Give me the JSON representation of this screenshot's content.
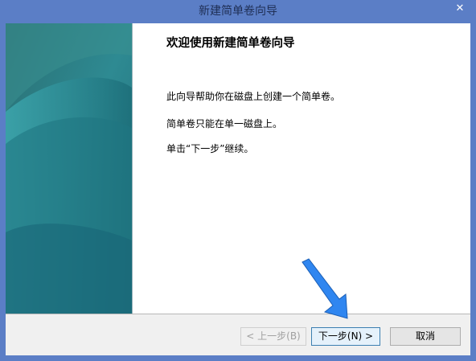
{
  "window": {
    "title": "新建简单卷向导",
    "close_label": "✕"
  },
  "content": {
    "heading": "欢迎使用新建简单卷向导",
    "paragraphs": [
      "此向导帮助你在磁盘上创建一个简单卷。",
      "简单卷只能在单一磁盘上。",
      "单击“下一步”继续。"
    ]
  },
  "buttons": {
    "back": "< 上一步(B)",
    "next": "下一步(N) >",
    "cancel": "取消"
  },
  "colors": {
    "title_bar": "#5b7ec6",
    "side_panel": "#2c7c86",
    "arrow": "#2f86f0"
  },
  "annotations": {
    "arrow_icon": "pointer-arrow-icon"
  }
}
